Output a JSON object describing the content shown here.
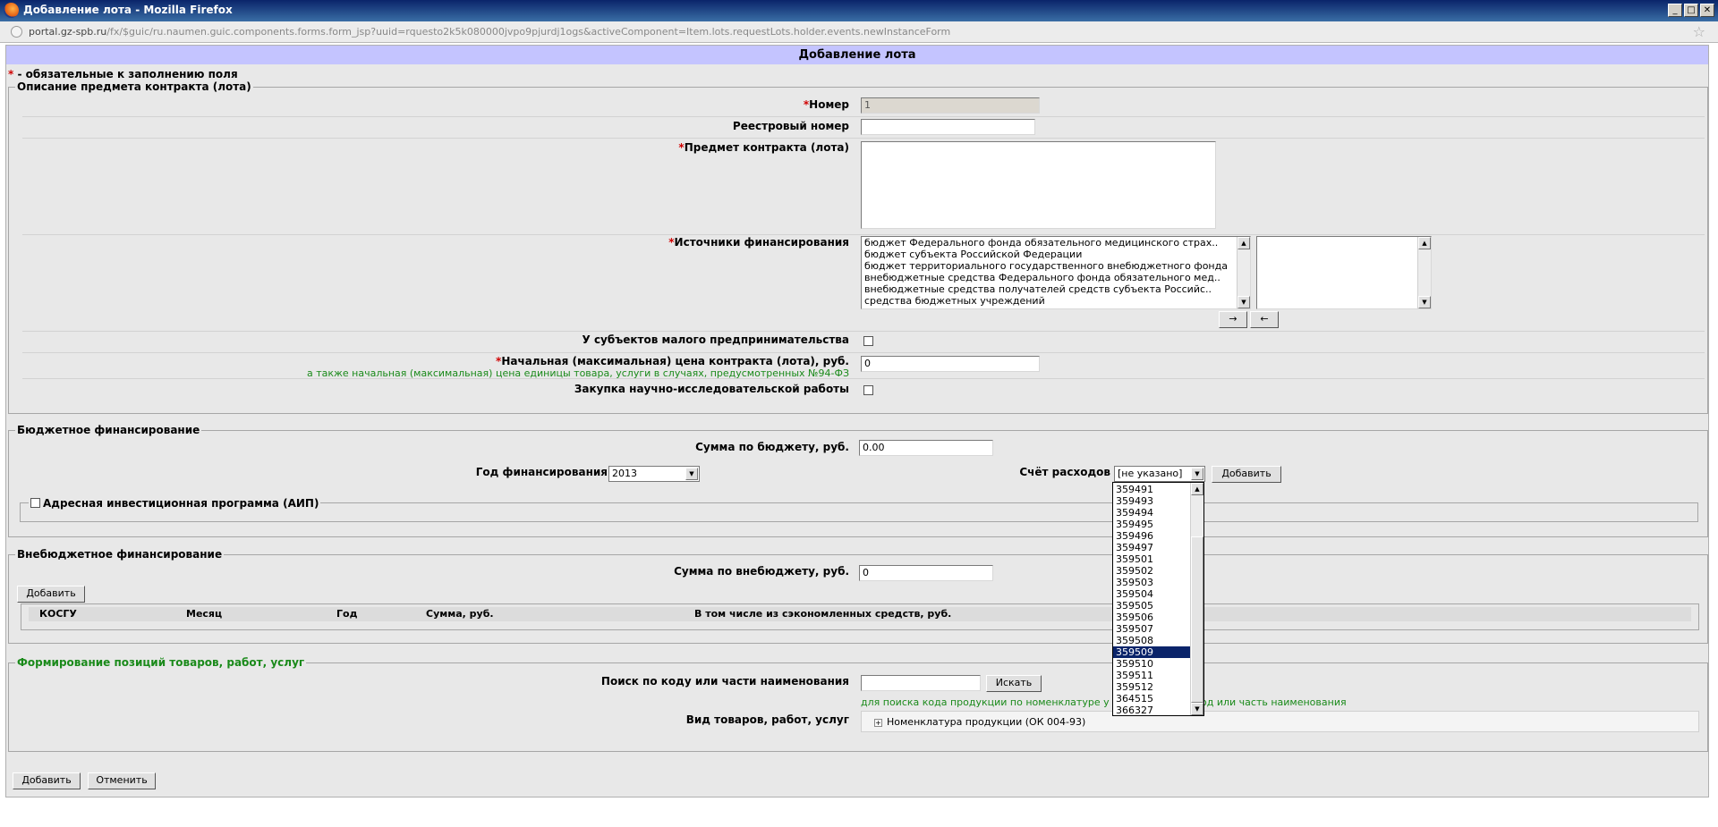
{
  "window": {
    "title": "Добавление лота - Mozilla Firefox"
  },
  "url": {
    "domain": "portal.gz-spb.ru",
    "rest": "/fx/$guic/ru.naumen.guic.components.forms.form_jsp?uuid=rquesto2k5k080000jvpo9pjurdj1ogs&activeComponent=Item.lots.requestLots.holder.events.newInstanceForm"
  },
  "form": {
    "header": "Добавление лота",
    "required_star": "*",
    "required_note": " - обязательные к заполнению поля"
  },
  "lot": {
    "legend": "Описание предмета контракта (лота)",
    "number_label": "Номер",
    "number_value": "1",
    "registry_label": "Реестровый номер",
    "registry_value": "",
    "subject_label": "Предмет контракта (лота)",
    "sources_label": "Источники финансирования",
    "sources_options": [
      "бюджет Федерального фонда обязательного медицинского страх..",
      "бюджет субъекта Российской Федерации",
      "бюджет территориального государственного внебюджетного фонда",
      "внебюджетные средства Федерального фонда обязательного мед..",
      "внебюджетные средства получателей средств субъекта Российс..",
      "средства бюджетных учреждений"
    ],
    "move_right": "→",
    "move_left": "←",
    "small_business_label": "У субъектов малого предпринимательства",
    "price_label": "Начальная (максимальная) цена контракта (лота), руб.",
    "price_note": "а также начальная (максимальная) цена единицы товара, услуги в случаях, предусмотренных №94-ФЗ",
    "price_value": "0",
    "research_label": "Закупка научно-исследовательской работы"
  },
  "budget": {
    "legend": "Бюджетное финансирование",
    "sum_label": "Сумма по бюджету, руб.",
    "sum_value": "0.00",
    "year_label": "Год финансирования",
    "year_value": "2013",
    "account_label": "Счёт расходов",
    "account_value": "[не указано]",
    "add_button": "Добавить",
    "aip_label": "Адресная инвестиционная программа (АИП)",
    "account_options": [
      "359491",
      "359493",
      "359494",
      "359495",
      "359496",
      "359497",
      "359501",
      "359502",
      "359503",
      "359504",
      "359505",
      "359506",
      "359507",
      "359508",
      "359509",
      "359510",
      "359511",
      "359512",
      "364515",
      "366327"
    ],
    "account_selected": "359509"
  },
  "extra": {
    "legend": "Внебюджетное финансирование",
    "sum_label": "Сумма по внебюджету, руб.",
    "sum_value": "0",
    "add_button": "Добавить",
    "columns": [
      "КОСГУ",
      "Месяц",
      "Год",
      "Сумма, руб.",
      "В том числе из сэкономленных средств, руб."
    ]
  },
  "goods": {
    "legend": "Формирование позиций товаров, работ, услуг",
    "search_label": "Поиск по коду или части наименования",
    "search_value": "",
    "search_button": "Искать",
    "search_hint_left": "для поиска кода продукции по номенклатуре у",
    "search_hint_right": "од или часть наименования",
    "kind_label": "Вид товаров, работ, услуг",
    "tree_plus": "+",
    "tree_item": "Номенклатура продукции (ОК 004-93)"
  },
  "actions": {
    "add": "Добавить",
    "cancel": "Отменить"
  }
}
